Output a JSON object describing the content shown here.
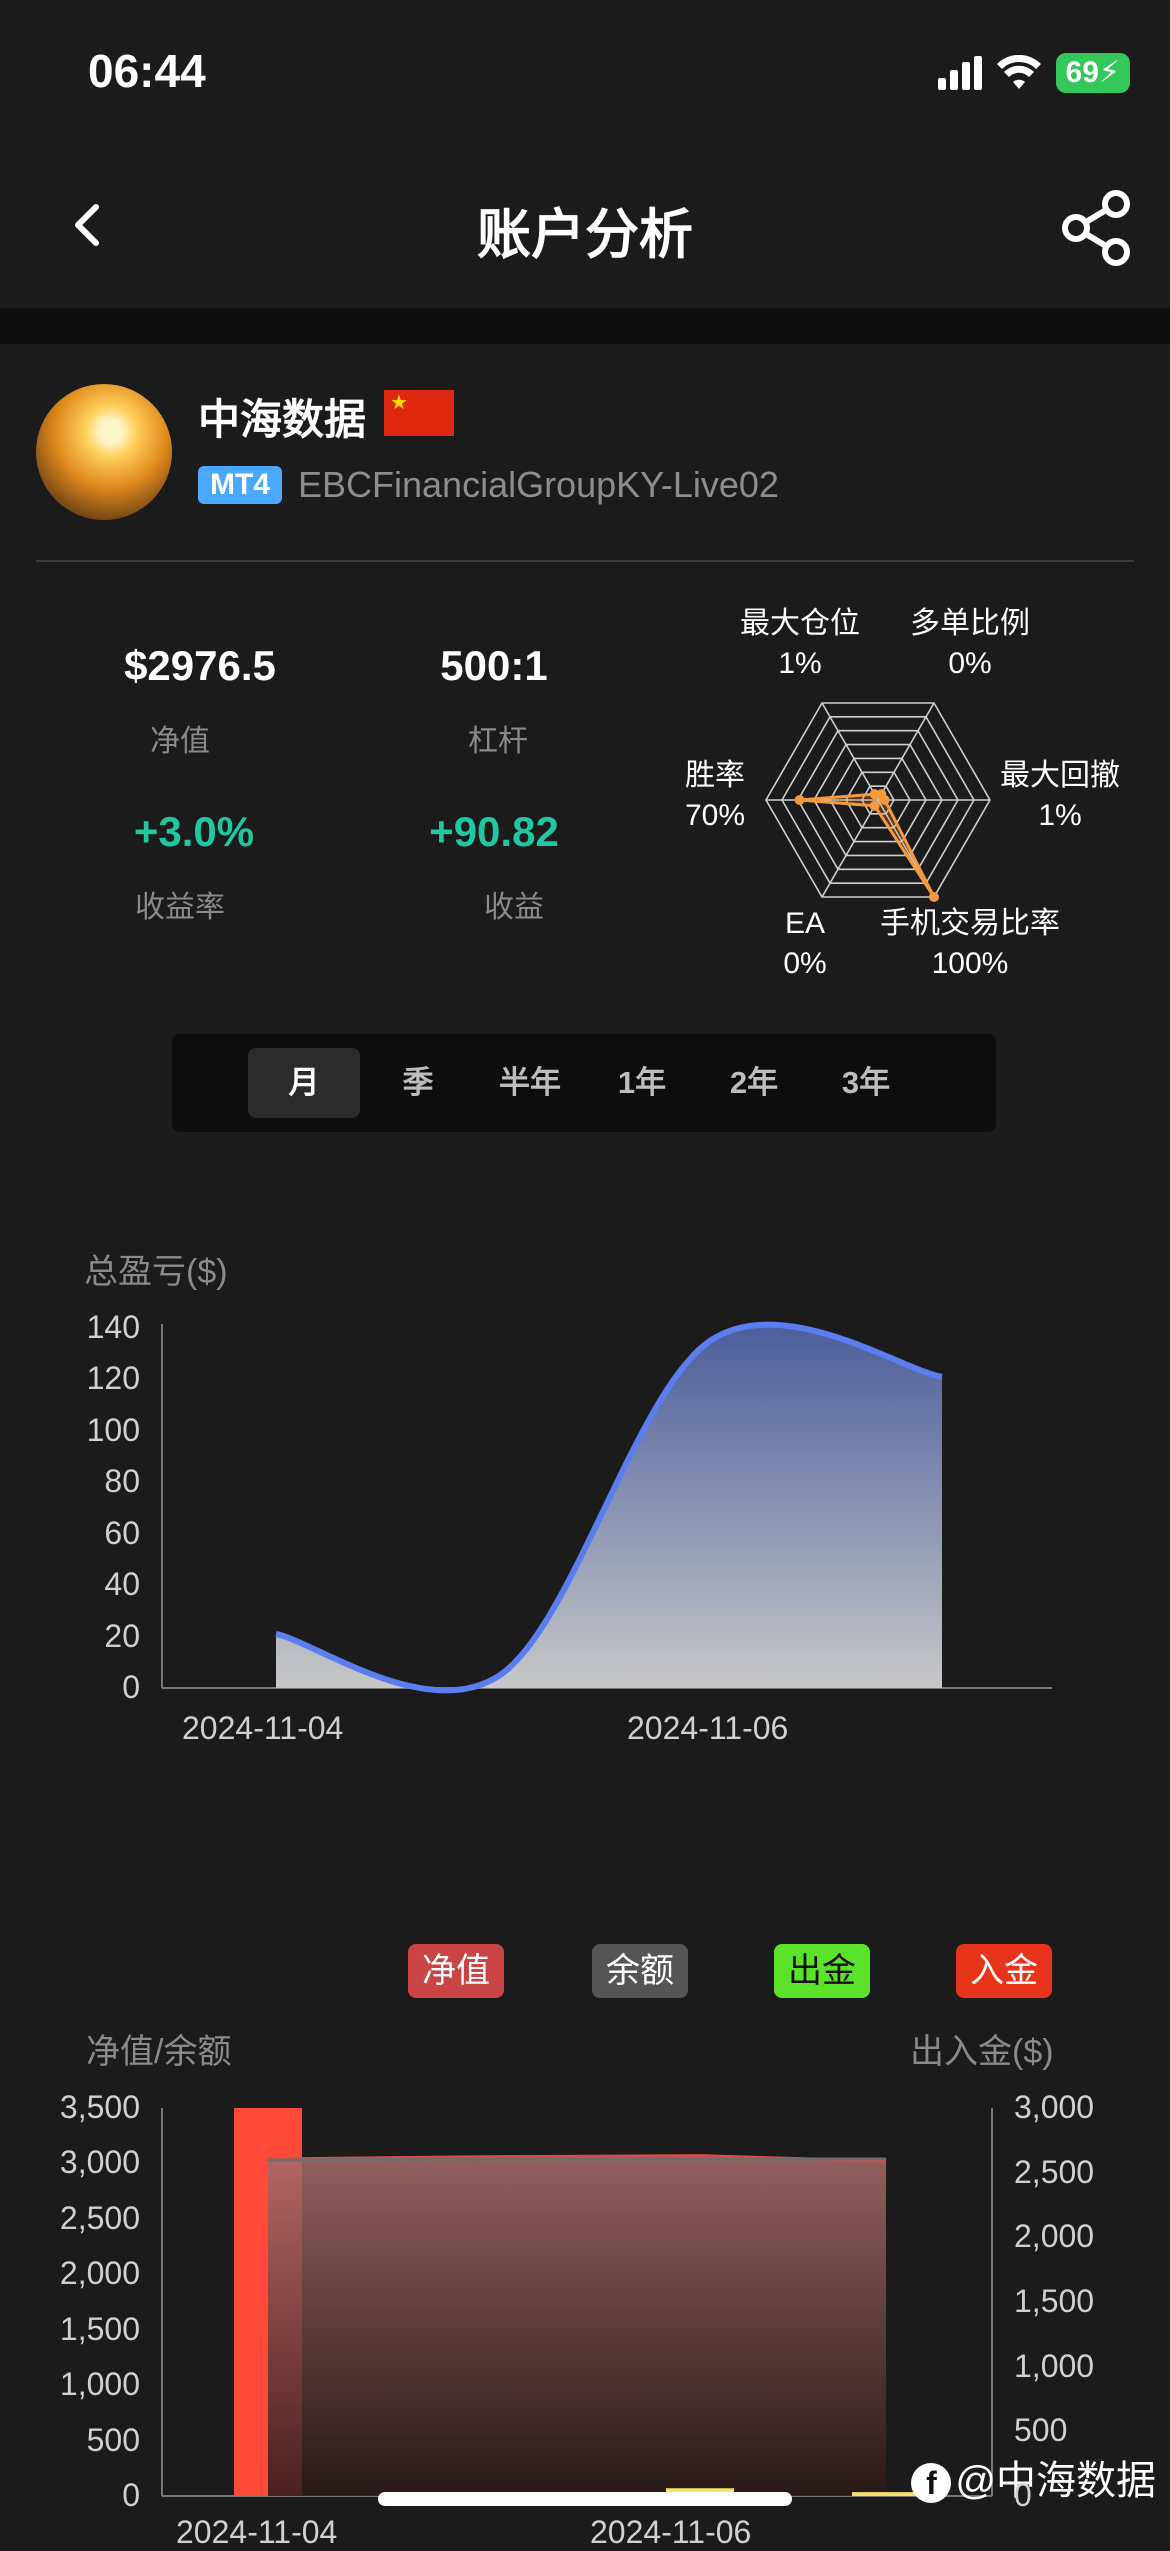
{
  "status_bar": {
    "time": "06:44",
    "battery": "69"
  },
  "nav": {
    "title": "账户分析"
  },
  "profile": {
    "name": "中海数据",
    "badge": "MT4",
    "account": "EBCFinancialGroupKY-Live02"
  },
  "stats": {
    "equity": {
      "value": "$2976.5",
      "label": "净值"
    },
    "leverage": {
      "value": "500:1",
      "label": "杠杆"
    },
    "return_rate": {
      "value": "+3.0%",
      "label": "收益率"
    },
    "profit": {
      "value": "+90.82",
      "label": "收益"
    }
  },
  "radar": {
    "labels": [
      {
        "name": "最大仓位",
        "value": "1%"
      },
      {
        "name": "多单比例",
        "value": "0%"
      },
      {
        "name": "最大回撤",
        "value": "1%"
      },
      {
        "name": "手机交易比率",
        "value": "100%"
      },
      {
        "name": "EA",
        "value": "0%"
      },
      {
        "name": "胜率",
        "value": "70%"
      }
    ]
  },
  "periods": [
    "月",
    "季",
    "半年",
    "1年",
    "2年",
    "3年"
  ],
  "active_period": "月",
  "pnl_chart": {
    "ylabel": "总盈亏($)",
    "yticks": [
      "140",
      "120",
      "100",
      "80",
      "60",
      "40",
      "20",
      "0"
    ],
    "xticks": [
      "2024-11-04",
      "2024-11-06"
    ]
  },
  "funds_chart": {
    "legend": [
      {
        "name": "净值",
        "color": "#d94b4b"
      },
      {
        "name": "余额",
        "color": "#5a5a5a"
      },
      {
        "name": "出金",
        "color": "#5be22a"
      },
      {
        "name": "入金",
        "color": "#e8341a"
      }
    ],
    "ylabel_left": "净值/余额",
    "ylabel_right": "出入金($)",
    "yticks_left": [
      "3,500",
      "3,000",
      "2,500",
      "2,000",
      "1,500",
      "1,000",
      "500",
      "0"
    ],
    "yticks_right": [
      "3,000",
      "2,500",
      "2,000",
      "1,500",
      "1,000",
      "500",
      "0"
    ],
    "xticks": [
      "2024-11-04",
      "2024-11-06"
    ]
  },
  "chart_data": [
    {
      "type": "radar",
      "categories": [
        "最大仓位",
        "多单比例",
        "最大回撤",
        "手机交易比率",
        "EA",
        "胜率"
      ],
      "values": [
        1,
        0,
        1,
        100,
        0,
        70
      ],
      "ylim": [
        0,
        100
      ]
    },
    {
      "type": "area",
      "ylabel": "总盈亏($)",
      "ylim": [
        0,
        140
      ],
      "x": [
        "2024-11-04",
        "2024-11-05",
        "2024-11-06",
        "2024-11-07"
      ],
      "values": [
        21,
        5,
        135,
        121
      ]
    },
    {
      "type": "bar",
      "ylabel": "净值/余额",
      "ylim": [
        0,
        3500
      ],
      "x": [
        "2024-11-04",
        "2024-11-05",
        "2024-11-06",
        "2024-11-07"
      ],
      "series": [
        {
          "name": "净值",
          "values": [
            3040,
            3060,
            3070,
            3020
          ]
        },
        {
          "name": "余额",
          "values": [
            3030,
            3040,
            3040,
            3040
          ]
        },
        {
          "name": "出金",
          "values": [
            0,
            0,
            60,
            30
          ]
        },
        {
          "name": "入金",
          "values": [
            3000,
            0,
            0,
            0
          ]
        }
      ],
      "y2label": "出入金($)",
      "y2lim": [
        0,
        3000
      ]
    }
  ]
}
